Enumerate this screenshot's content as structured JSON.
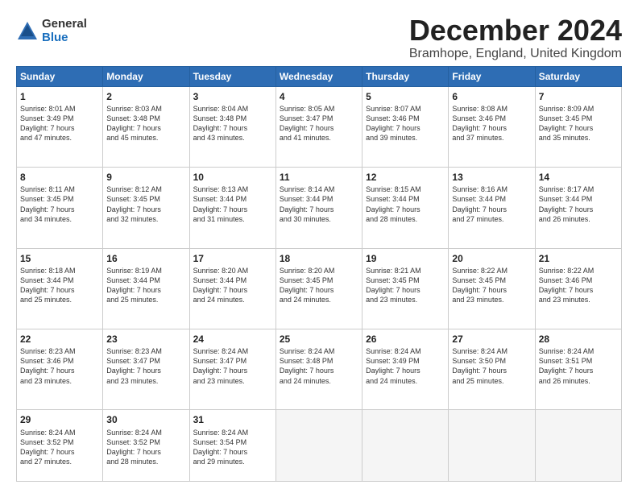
{
  "logo": {
    "general": "General",
    "blue": "Blue"
  },
  "title": {
    "month": "December 2024",
    "location": "Bramhope, England, United Kingdom"
  },
  "days_header": [
    "Sunday",
    "Monday",
    "Tuesday",
    "Wednesday",
    "Thursday",
    "Friday",
    "Saturday"
  ],
  "weeks": [
    [
      {
        "day": "1",
        "info": "Sunrise: 8:01 AM\nSunset: 3:49 PM\nDaylight: 7 hours\nand 47 minutes."
      },
      {
        "day": "2",
        "info": "Sunrise: 8:03 AM\nSunset: 3:48 PM\nDaylight: 7 hours\nand 45 minutes."
      },
      {
        "day": "3",
        "info": "Sunrise: 8:04 AM\nSunset: 3:48 PM\nDaylight: 7 hours\nand 43 minutes."
      },
      {
        "day": "4",
        "info": "Sunrise: 8:05 AM\nSunset: 3:47 PM\nDaylight: 7 hours\nand 41 minutes."
      },
      {
        "day": "5",
        "info": "Sunrise: 8:07 AM\nSunset: 3:46 PM\nDaylight: 7 hours\nand 39 minutes."
      },
      {
        "day": "6",
        "info": "Sunrise: 8:08 AM\nSunset: 3:46 PM\nDaylight: 7 hours\nand 37 minutes."
      },
      {
        "day": "7",
        "info": "Sunrise: 8:09 AM\nSunset: 3:45 PM\nDaylight: 7 hours\nand 35 minutes."
      }
    ],
    [
      {
        "day": "8",
        "info": "Sunrise: 8:11 AM\nSunset: 3:45 PM\nDaylight: 7 hours\nand 34 minutes."
      },
      {
        "day": "9",
        "info": "Sunrise: 8:12 AM\nSunset: 3:45 PM\nDaylight: 7 hours\nand 32 minutes."
      },
      {
        "day": "10",
        "info": "Sunrise: 8:13 AM\nSunset: 3:44 PM\nDaylight: 7 hours\nand 31 minutes."
      },
      {
        "day": "11",
        "info": "Sunrise: 8:14 AM\nSunset: 3:44 PM\nDaylight: 7 hours\nand 30 minutes."
      },
      {
        "day": "12",
        "info": "Sunrise: 8:15 AM\nSunset: 3:44 PM\nDaylight: 7 hours\nand 28 minutes."
      },
      {
        "day": "13",
        "info": "Sunrise: 8:16 AM\nSunset: 3:44 PM\nDaylight: 7 hours\nand 27 minutes."
      },
      {
        "day": "14",
        "info": "Sunrise: 8:17 AM\nSunset: 3:44 PM\nDaylight: 7 hours\nand 26 minutes."
      }
    ],
    [
      {
        "day": "15",
        "info": "Sunrise: 8:18 AM\nSunset: 3:44 PM\nDaylight: 7 hours\nand 25 minutes."
      },
      {
        "day": "16",
        "info": "Sunrise: 8:19 AM\nSunset: 3:44 PM\nDaylight: 7 hours\nand 25 minutes."
      },
      {
        "day": "17",
        "info": "Sunrise: 8:20 AM\nSunset: 3:44 PM\nDaylight: 7 hours\nand 24 minutes."
      },
      {
        "day": "18",
        "info": "Sunrise: 8:20 AM\nSunset: 3:45 PM\nDaylight: 7 hours\nand 24 minutes."
      },
      {
        "day": "19",
        "info": "Sunrise: 8:21 AM\nSunset: 3:45 PM\nDaylight: 7 hours\nand 23 minutes."
      },
      {
        "day": "20",
        "info": "Sunrise: 8:22 AM\nSunset: 3:45 PM\nDaylight: 7 hours\nand 23 minutes."
      },
      {
        "day": "21",
        "info": "Sunrise: 8:22 AM\nSunset: 3:46 PM\nDaylight: 7 hours\nand 23 minutes."
      }
    ],
    [
      {
        "day": "22",
        "info": "Sunrise: 8:23 AM\nSunset: 3:46 PM\nDaylight: 7 hours\nand 23 minutes."
      },
      {
        "day": "23",
        "info": "Sunrise: 8:23 AM\nSunset: 3:47 PM\nDaylight: 7 hours\nand 23 minutes."
      },
      {
        "day": "24",
        "info": "Sunrise: 8:24 AM\nSunset: 3:47 PM\nDaylight: 7 hours\nand 23 minutes."
      },
      {
        "day": "25",
        "info": "Sunrise: 8:24 AM\nSunset: 3:48 PM\nDaylight: 7 hours\nand 24 minutes."
      },
      {
        "day": "26",
        "info": "Sunrise: 8:24 AM\nSunset: 3:49 PM\nDaylight: 7 hours\nand 24 minutes."
      },
      {
        "day": "27",
        "info": "Sunrise: 8:24 AM\nSunset: 3:50 PM\nDaylight: 7 hours\nand 25 minutes."
      },
      {
        "day": "28",
        "info": "Sunrise: 8:24 AM\nSunset: 3:51 PM\nDaylight: 7 hours\nand 26 minutes."
      }
    ],
    [
      {
        "day": "29",
        "info": "Sunrise: 8:24 AM\nSunset: 3:52 PM\nDaylight: 7 hours\nand 27 minutes."
      },
      {
        "day": "30",
        "info": "Sunrise: 8:24 AM\nSunset: 3:52 PM\nDaylight: 7 hours\nand 28 minutes."
      },
      {
        "day": "31",
        "info": "Sunrise: 8:24 AM\nSunset: 3:54 PM\nDaylight: 7 hours\nand 29 minutes."
      },
      {
        "day": "",
        "info": ""
      },
      {
        "day": "",
        "info": ""
      },
      {
        "day": "",
        "info": ""
      },
      {
        "day": "",
        "info": ""
      }
    ]
  ]
}
